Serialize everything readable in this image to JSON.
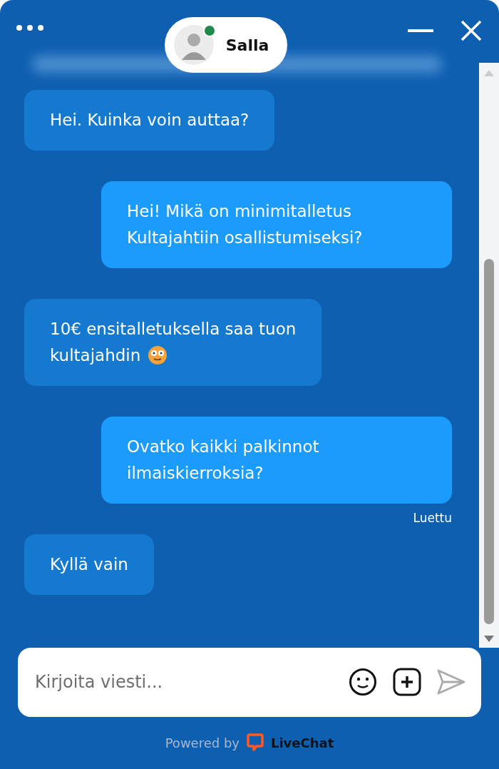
{
  "header": {
    "agent_name": "Salla",
    "online": true
  },
  "messages": [
    {
      "kind": "agent",
      "lines": [
        "Hei. Kuinka voin auttaa?"
      ]
    },
    {
      "kind": "visitor",
      "lines": [
        "Hei! Mikä on minimitalletus",
        "Kultajahtiin osallistumiseksi?"
      ]
    },
    {
      "kind": "agent",
      "lines": [
        "10€ ensitalletuksella saa tuon",
        "kultajahdin"
      ],
      "emoji": true
    },
    {
      "kind": "visitor",
      "lines": [
        "Ovatko kaikki palkinnot",
        "ilmaiskierroksia?"
      ],
      "status": "Luettu"
    },
    {
      "kind": "agent",
      "lines": [
        "Kyllä vain"
      ]
    }
  ],
  "composer": {
    "placeholder": "Kirjoita viesti..."
  },
  "footer": {
    "powered_by": "Powered by",
    "brand": "LiveChat"
  }
}
